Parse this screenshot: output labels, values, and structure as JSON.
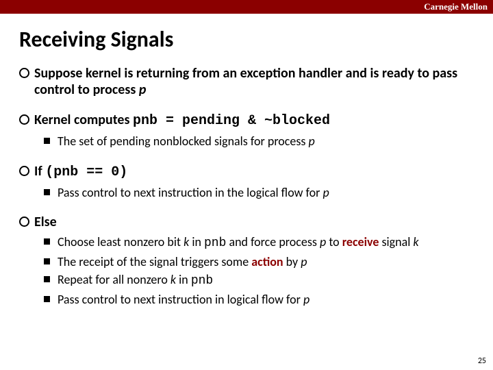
{
  "brand": "Carnegie Mellon",
  "title": "Receiving Signals",
  "bullets": {
    "b1": {
      "a": "Suppose kernel is returning from an exception handler and is ready to pass control to process ",
      "p": "p"
    },
    "b2": {
      "a": "Kernel computes ",
      "code": "pnb = pending & ~blocked",
      "sub1a": "The set of pending nonblocked signals for process ",
      "sub1p": "p"
    },
    "b3": {
      "a": "If ",
      "code": "(pnb == 0)",
      "sub1a": "Pass control to next instruction in the logical flow for ",
      "sub1p": "p"
    },
    "b4": {
      "a": "Else",
      "sub1a": "Choose least nonzero bit ",
      "sub1k": "k",
      "sub1b": " in ",
      "sub1code": "pnb",
      "sub1c": "  and force process ",
      "sub1p": "p",
      "sub1d": " to ",
      "sub1recv": "receive",
      "sub1e": " signal ",
      "sub1k2": "k",
      "sub2a": "The receipt of the signal triggers some ",
      "sub2act": "action",
      "sub2b": " by ",
      "sub2p": "p",
      "sub3a": "Repeat for all nonzero ",
      "sub3k": "k",
      "sub3b": " in ",
      "sub3code": "pnb",
      "sub4a": "Pass control to next instruction in logical flow for ",
      "sub4p": "p"
    }
  },
  "pagenum": "25"
}
